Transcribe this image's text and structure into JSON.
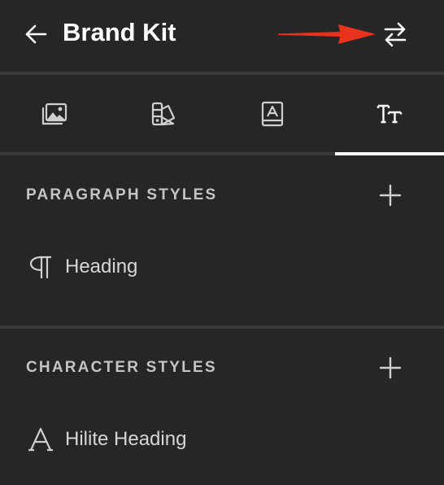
{
  "header": {
    "title": "Brand Kit",
    "back_icon": "arrow-left-icon",
    "switch_icon": "swap-arrows-icon"
  },
  "tabs": [
    {
      "id": "images",
      "icon": "image-gallery-icon",
      "active": false
    },
    {
      "id": "colors",
      "icon": "color-swatch-icon",
      "active": false
    },
    {
      "id": "fonts",
      "icon": "font-book-icon",
      "active": false
    },
    {
      "id": "text-styles",
      "icon": "text-style-icon",
      "active": true
    }
  ],
  "paragraph_styles": {
    "heading": "PARAGRAPH STYLES",
    "add_icon": "plus-icon",
    "items": [
      {
        "label": "Heading",
        "icon": "pilcrow-icon"
      }
    ]
  },
  "character_styles": {
    "heading": "CHARACTER STYLES",
    "add_icon": "plus-icon",
    "items": [
      {
        "label": "Hilite Heading",
        "icon": "letter-a-icon"
      }
    ]
  },
  "colors": {
    "background": "#262626",
    "divider": "#3a3a3a",
    "active_indicator": "#ffffff",
    "annotation_arrow": "#e8321e"
  }
}
